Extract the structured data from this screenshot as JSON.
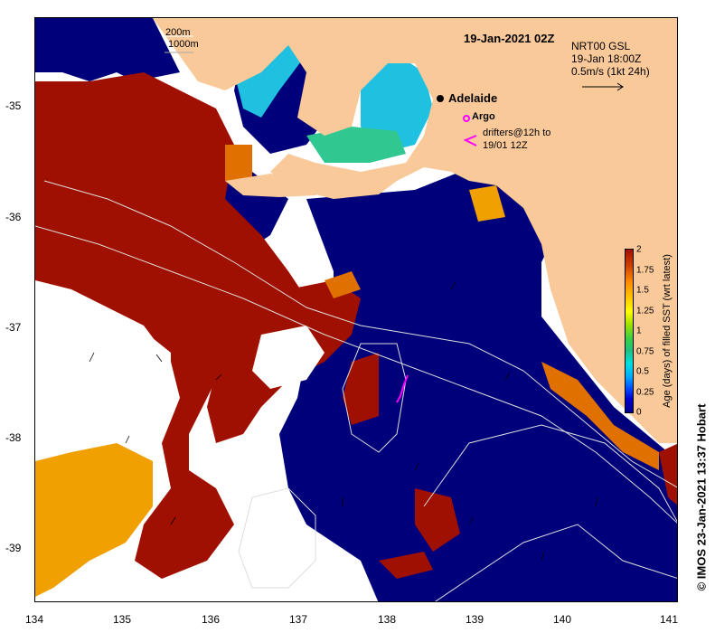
{
  "map": {
    "title": "19-Jan-2021 02Z",
    "product": "NRT00 GSL",
    "valid_time": "19-Jan 18:00Z",
    "scale_label": "0.5m/s (1kt 24h)",
    "contour_labels": [
      "200m",
      "1000m"
    ],
    "city": "Adelaide",
    "argo_label": "Argo",
    "drifters_label": "drifters@12h to 19/01 12Z",
    "x_ticks": [
      "134",
      "135",
      "136",
      "137",
      "138",
      "139",
      "140",
      "141"
    ],
    "y_ticks": [
      "-35",
      "-36",
      "-37",
      "-38",
      "-39"
    ],
    "colorbar": {
      "title": "Age (days) of filled SST (wrt latest)",
      "ticks": [
        "2",
        "1.75",
        "1.5",
        "1.25",
        "1",
        "0.75",
        "0.5",
        "0.25",
        "0"
      ]
    },
    "credit": "© IMOS 23-Jan-2021 13:37 Hobart",
    "colors": {
      "land": "#f9c99a",
      "ocean_recent": "#00007a",
      "old_data": "#a01000",
      "mid_data": "#e07000",
      "cyan_data": "#20c0e0",
      "argo": "#ff00ff"
    }
  }
}
